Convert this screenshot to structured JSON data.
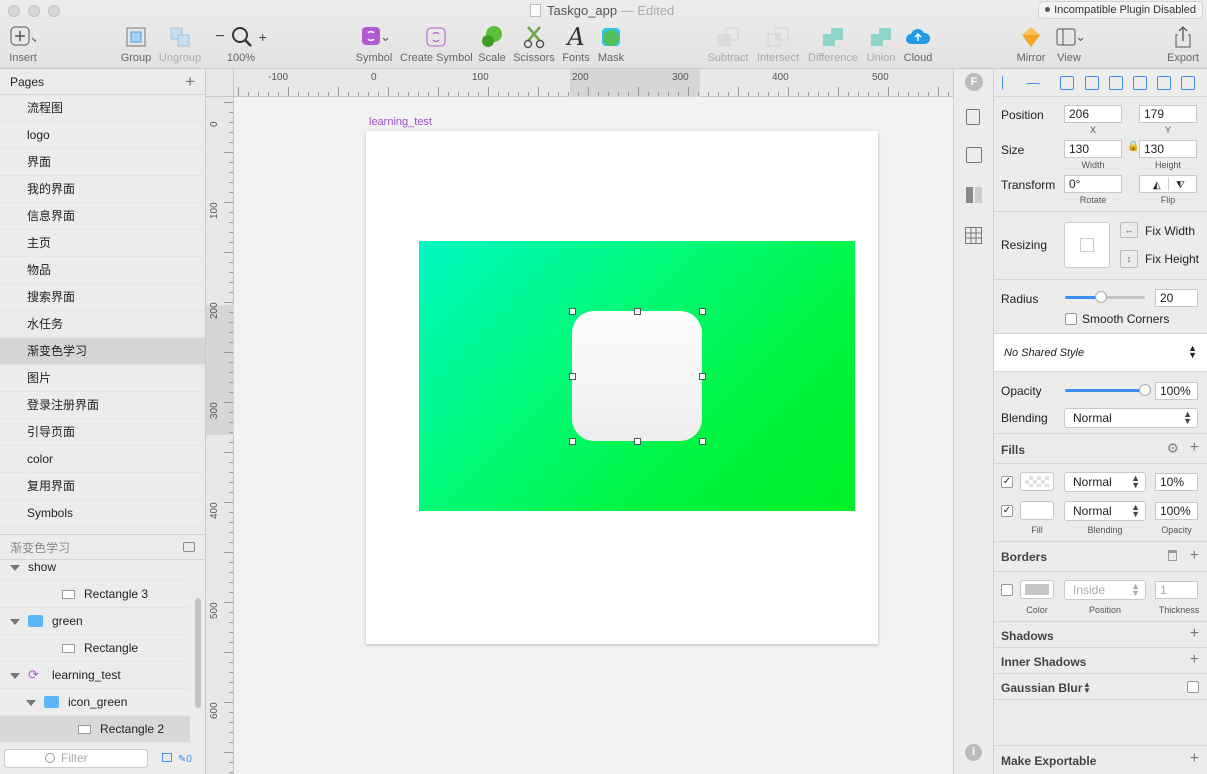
{
  "window": {
    "title": "Taskgo_app",
    "edited": "— Edited",
    "plugin_status": "Incompatible Plugin Disabled"
  },
  "toolbar": {
    "insert": "Insert",
    "group": "Group",
    "ungroup": "Ungroup",
    "zoom": "100%",
    "symbol": "Symbol",
    "create_symbol": "Create Symbol",
    "scale": "Scale",
    "scissors": "Scissors",
    "fonts": "Fonts",
    "mask": "Mask",
    "subtract": "Subtract",
    "intersect": "Intersect",
    "difference": "Difference",
    "union": "Union",
    "cloud": "Cloud",
    "mirror": "Mirror",
    "view": "View",
    "export": "Export"
  },
  "pages": {
    "header": "Pages",
    "items": [
      "流程图",
      "logo",
      "界面",
      "我的界面",
      "信息界面",
      "主页",
      "物品",
      "搜索界面",
      "水任务",
      "渐变色学习",
      "图片",
      "登录注册界面",
      "引导页面",
      "color",
      "复用界面",
      "Symbols"
    ],
    "selected": "渐变色学习"
  },
  "layers": {
    "header": "渐变色学习",
    "items": [
      {
        "name": "show",
        "type": "group"
      },
      {
        "name": "Rectangle 3",
        "type": "rect"
      },
      {
        "name": "green",
        "type": "folder"
      },
      {
        "name": "Rectangle",
        "type": "rect"
      },
      {
        "name": "learning_test",
        "type": "symbol"
      },
      {
        "name": "icon_green",
        "type": "folder"
      },
      {
        "name": "Rectangle 2",
        "type": "rect"
      }
    ],
    "filter_placeholder": "Filter",
    "filter_count": "0"
  },
  "canvas": {
    "artboard_name": "learning_test",
    "ruler_top": [
      "-100",
      "0",
      "100",
      "200",
      "300",
      "400",
      "500"
    ],
    "ruler_left": [
      "0",
      "100",
      "200",
      "300",
      "400",
      "500",
      "600"
    ]
  },
  "inspector": {
    "position": {
      "label": "Position",
      "x": "206",
      "y": "179",
      "x_label": "X",
      "y_label": "Y"
    },
    "size": {
      "label": "Size",
      "w": "130",
      "h": "130",
      "w_label": "Width",
      "h_label": "Height"
    },
    "transform": {
      "label": "Transform",
      "rotate": "0°",
      "rotate_label": "Rotate",
      "flip_label": "Flip"
    },
    "resizing": {
      "label": "Resizing",
      "fix_width": "Fix Width",
      "fix_height": "Fix Height"
    },
    "radius": {
      "label": "Radius",
      "value": "20",
      "smooth": "Smooth Corners",
      "level": 0.45
    },
    "shared_style": "No Shared Style",
    "opacity": {
      "label": "Opacity",
      "value": "100%",
      "level": 1.0
    },
    "blending": {
      "label": "Blending",
      "value": "Normal"
    },
    "fills": {
      "header": "Fills",
      "rows": [
        {
          "blend": "Normal",
          "opacity": "10%"
        },
        {
          "blend": "Normal",
          "opacity": "100%"
        }
      ],
      "col_fill": "Fill",
      "col_blending": "Blending",
      "col_opacity": "Opacity"
    },
    "borders": {
      "header": "Borders",
      "position": "Inside",
      "thickness": "1",
      "col_color": "Color",
      "col_position": "Position",
      "col_thickness": "Thickness"
    },
    "shadows": "Shadows",
    "inner_shadows": "Inner Shadows",
    "gaussian_blur": "Gaussian Blur",
    "make_exportable": "Make Exportable"
  },
  "colors": {
    "gradient_start": "#00f7c2",
    "gradient_end": "#00f028",
    "accent": "#3b8ff5",
    "symbol": "#b25ad1"
  }
}
